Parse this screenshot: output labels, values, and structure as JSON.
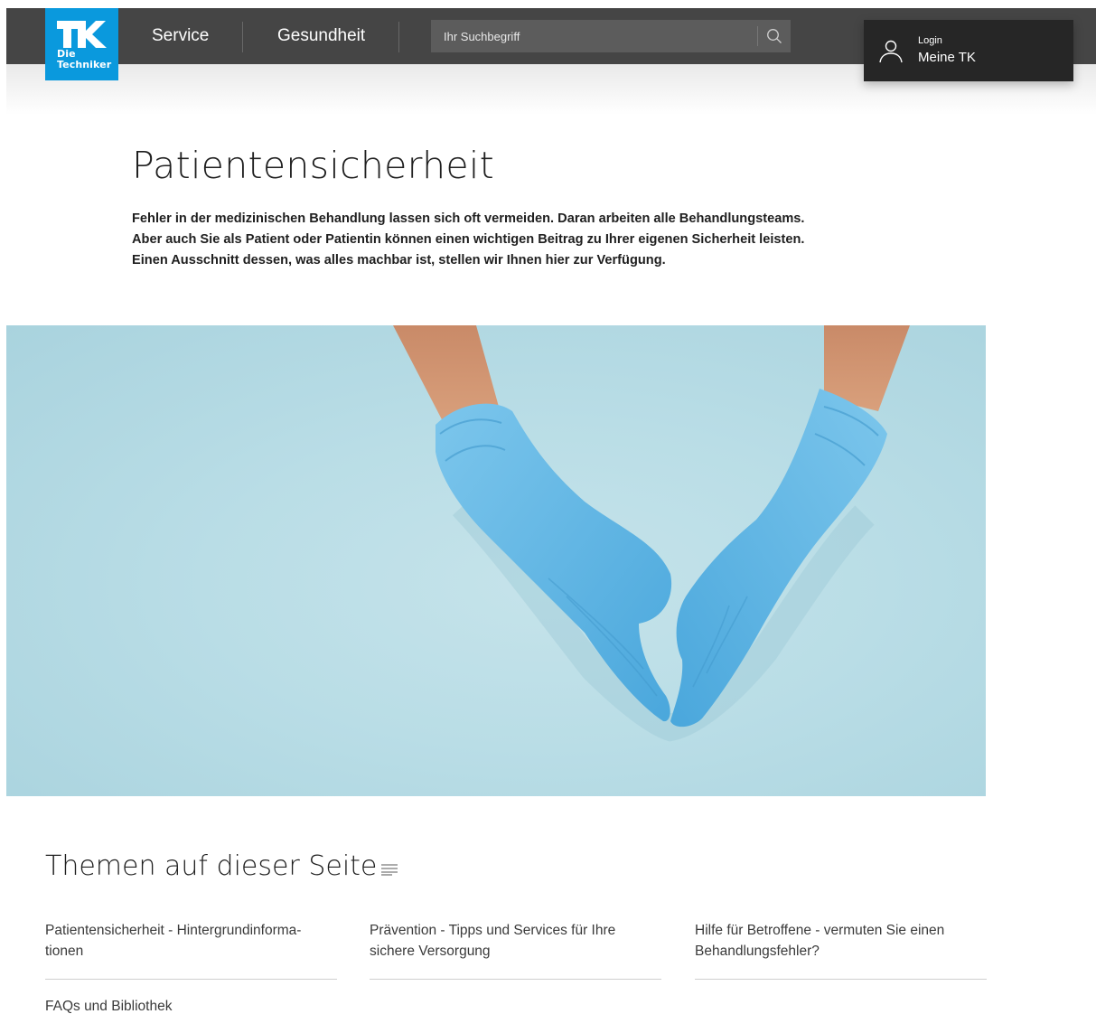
{
  "brand": {
    "logo_text_line1": "Die",
    "logo_text_line2": "Techniker",
    "color": "#0a99dd"
  },
  "nav": {
    "items": [
      {
        "label": "Service"
      },
      {
        "label": "Gesundheit"
      }
    ]
  },
  "search": {
    "placeholder": "Ihr Suchbegriff",
    "value": "",
    "icon": "search-icon"
  },
  "login": {
    "small_label": "Login",
    "label": "Meine TK",
    "icon": "user-icon"
  },
  "page": {
    "title": "Patientensicherheit",
    "intro": "Fehler in der medizinischen Behandlung lassen sich oft vermeiden. Daran arbeiten alle Behandlungsteams. Aber auch Sie als Patient oder Patientin können einen wichtigen Beitrag zu Ihrer eigenen Sicherheit leisten. Einen Ausschnitt dessen, was alles machbar ist, stellen wir Ihnen hier zur Verfügung."
  },
  "hero": {
    "image": "hands-in-blue-gloves-forming-heart",
    "background_color": "#b9dde6",
    "glove_color": "#5fb6e4"
  },
  "topics": {
    "heading": "Themen auf dieser Seite",
    "heading_icon": "list-icon",
    "items": [
      {
        "label_line1": "Patientensicherheit - Hintergrundinforma-",
        "label_line2": "tionen"
      },
      {
        "label_line1": "Prävention - Tipps und Services für Ihre",
        "label_line2": "sichere Versorgung"
      },
      {
        "label_line1": "Hilfe für Betroffene - vermuten Sie einen",
        "label_line2": "Behandlungsfehler?"
      },
      {
        "label_line1": "FAQs und Bibliothek"
      }
    ]
  }
}
